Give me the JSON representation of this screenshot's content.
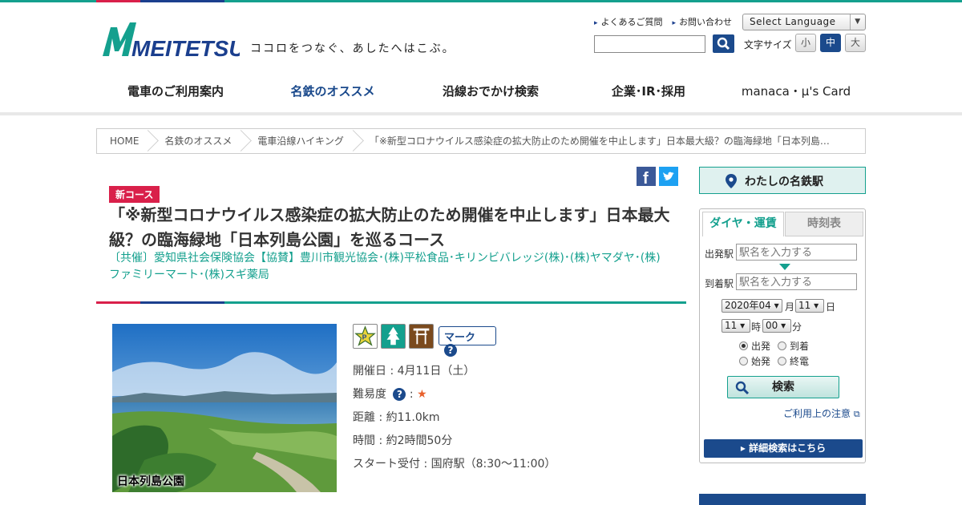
{
  "brand": {
    "logo_text": "MEITETSU",
    "tagline": "ココロをつなぐ、あしたへはこぶ。"
  },
  "header": {
    "links": [
      "よくあるご質問",
      "お問い合わせ"
    ],
    "language": "Select Language",
    "fontsize_label": "文字サイズ",
    "fontsizes": [
      "小",
      "中",
      "大"
    ],
    "fontsize_active": "中"
  },
  "nav": {
    "items": [
      "電車のご利用案内",
      "名鉄のオススメ",
      "沿線おでかけ検索",
      "企業･IR･採用",
      "manaca・μ's Card"
    ],
    "active": "名鉄のオススメ"
  },
  "breadcrumb": [
    "HOME",
    "名鉄のオススメ",
    "電車沿線ハイキング",
    "「※新型コロナウイルス感染症の拡大防止のため開催を中止します」日本最大級？の臨海緑地「日本列島…"
  ],
  "article": {
    "badge": "新コース",
    "title": "「※新型コロナウイルス感染症の拡大防止のため開催を中止します」日本最大級？の臨海緑地「日本列島公園」を巡るコース",
    "sponsor": "〔共催〕愛知県社会保険協会【協賛】豊川市観光協会･(株)平松食品･キリンビバレッジ(株)･(株)ヤマダヤ･(株)ファミリーマート･(株)スギ薬局",
    "photo_caption": "日本列島公園",
    "mark_label": "マーク",
    "date": "開催日 : 4月11日（土）",
    "difficulty_label": "難易度",
    "difficulty_stars": "★",
    "distance": "距離 : 約11.0km",
    "time": "時間 : 約2時間50分",
    "start": "スタート受付 : 国府駅（8:30～11:00）"
  },
  "sidebar": {
    "my_station": "わたしの名鉄駅",
    "tabs": [
      "ダイヤ・運賃",
      "時刻表"
    ],
    "from_label": "出発駅",
    "to_label": "到着駅",
    "placeholder": "駅名を入力する",
    "year_month": "2020年04",
    "month_unit": "月",
    "day": "11",
    "day_unit": "日",
    "hour": "11",
    "hour_unit": "時",
    "minute": "00",
    "minute_unit": "分",
    "radios": [
      "出発",
      "到着",
      "始発",
      "終電"
    ],
    "search_button": "検索",
    "note": "ご利用上の注意",
    "detail_button": "詳細検索はこちら"
  },
  "colors": {
    "teal": "#14a08e",
    "navy": "#1b4a8c",
    "red": "#d9204a"
  }
}
